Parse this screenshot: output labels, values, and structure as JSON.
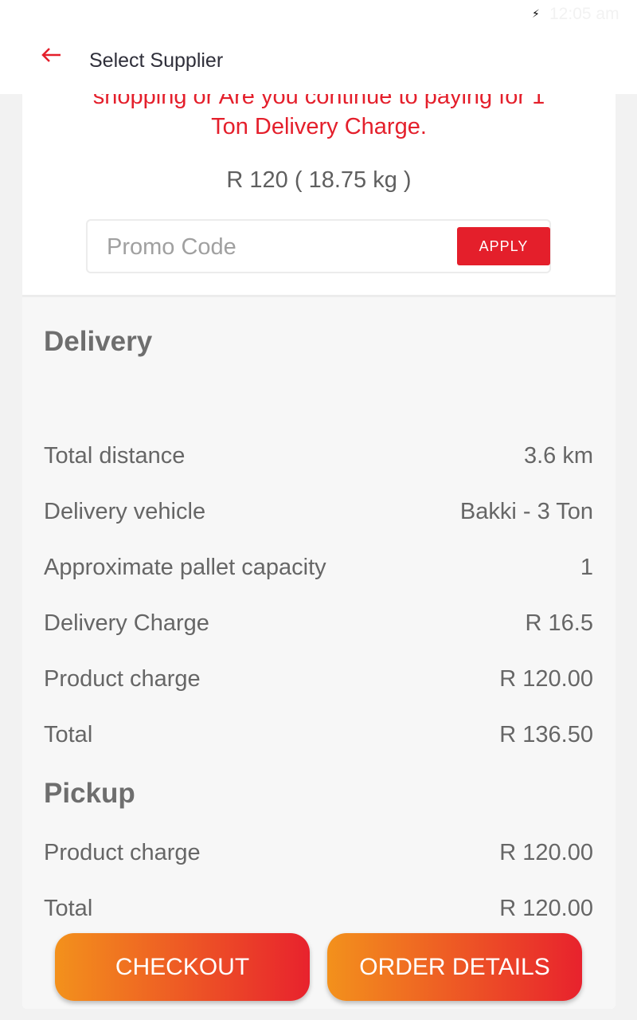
{
  "status_bar": {
    "time": "12:05 am",
    "charging_icon": "bolt-icon"
  },
  "toolbar": {
    "back_icon": "arrow-left-icon",
    "title": "Select Supplier"
  },
  "warning": {
    "line1": "shopping or Are you continue to  paying for 1",
    "line2": "Ton Delivery Charge."
  },
  "price_summary": "R 120  ( 18.75 kg )",
  "promo": {
    "placeholder": "Promo Code",
    "value": "",
    "apply_label": "APPLY"
  },
  "delivery": {
    "title": "Delivery",
    "rows": [
      {
        "label": "Total distance",
        "value": "3.6 km"
      },
      {
        "label": "Delivery vehicle",
        "value": "Bakki - 3 Ton"
      },
      {
        "label": "Approximate pallet capacity",
        "value": "1"
      },
      {
        "label": "Delivery Charge",
        "value": "R 16.5"
      },
      {
        "label": "Product charge",
        "value": "R 120.00"
      },
      {
        "label": "Total",
        "value": "R 136.50"
      }
    ]
  },
  "pickup": {
    "title": "Pickup",
    "rows": [
      {
        "label": "Product charge",
        "value": "R 120.00"
      },
      {
        "label": "Total",
        "value": "R 120.00"
      }
    ]
  },
  "buttons": {
    "checkout": "CHECKOUT",
    "order_details": "ORDER DETAILS"
  },
  "colors": {
    "accent_red": "#e41f2b",
    "gradient_start": "#f3911c",
    "gradient_end": "#e8222d"
  }
}
